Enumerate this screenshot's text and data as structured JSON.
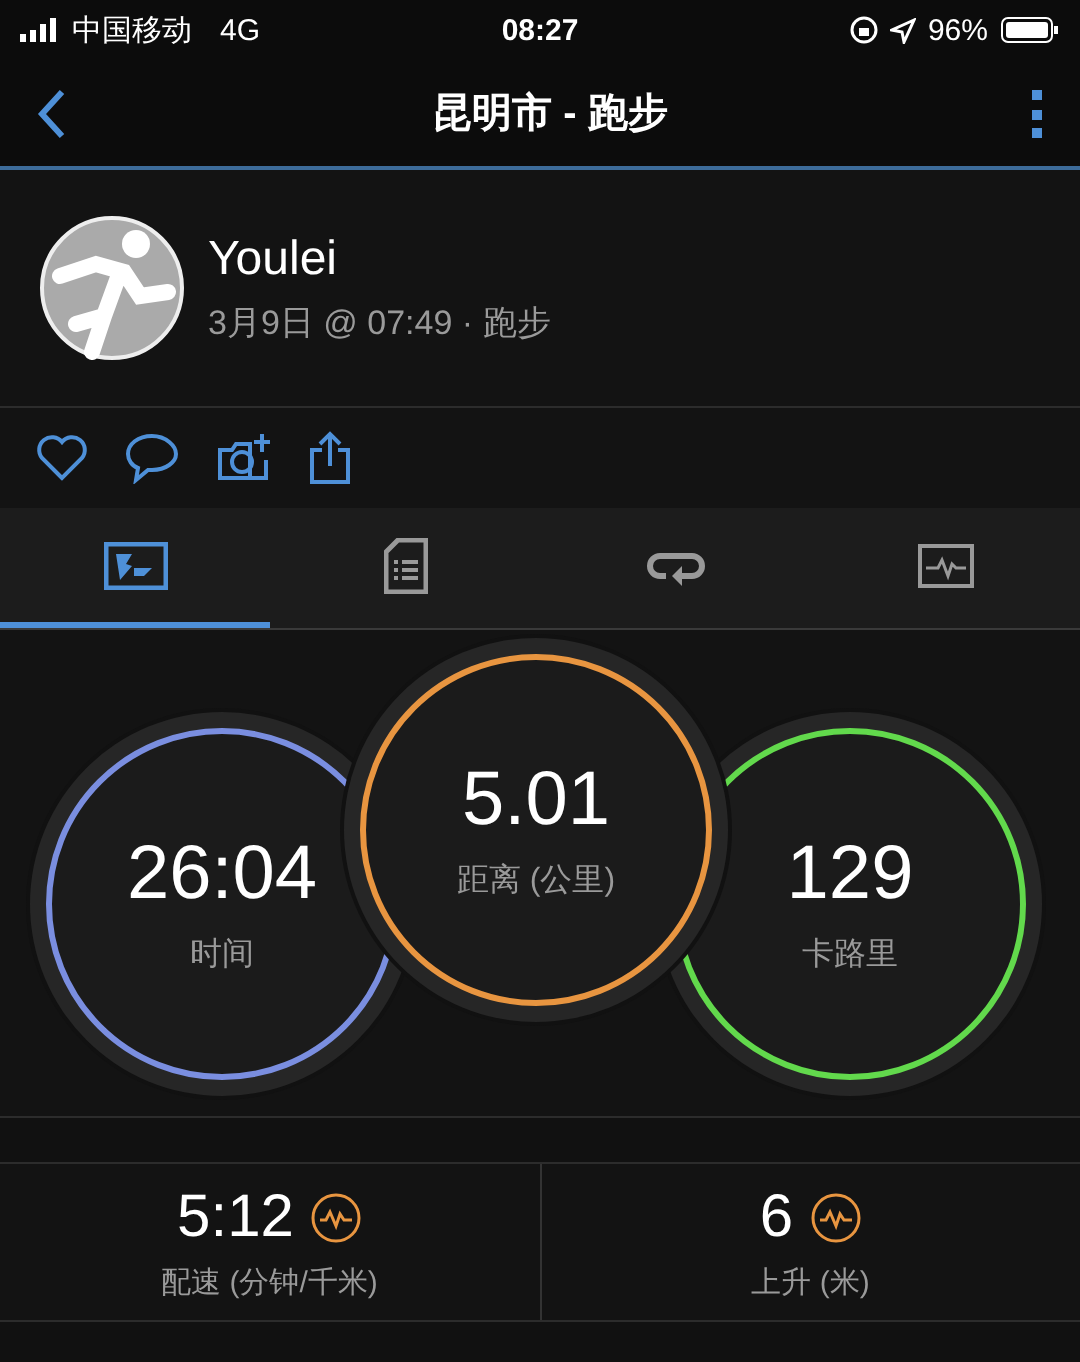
{
  "status_bar": {
    "carrier": "中国移动",
    "network": "4G",
    "time": "08:27",
    "battery": "96%"
  },
  "header": {
    "title": "昆明市 - 跑步"
  },
  "activity": {
    "user": "Youlei",
    "meta": "3月9日 @ 07:49 · 跑步"
  },
  "tabs": [
    {
      "selected": true
    },
    {
      "selected": false
    },
    {
      "selected": false
    },
    {
      "selected": false
    }
  ],
  "rings": [
    {
      "value": "26:04",
      "label": "时间",
      "color": "#7a8ee0"
    },
    {
      "value": "5.01",
      "label": "距离 (公里)",
      "color": "#e89540"
    },
    {
      "value": "129",
      "label": "卡路里",
      "color": "#62d94c"
    }
  ],
  "stats": [
    {
      "value": "5:12",
      "label": "配速 (分钟/千米)"
    },
    {
      "value": "6",
      "label": "上升 (米)"
    }
  ]
}
